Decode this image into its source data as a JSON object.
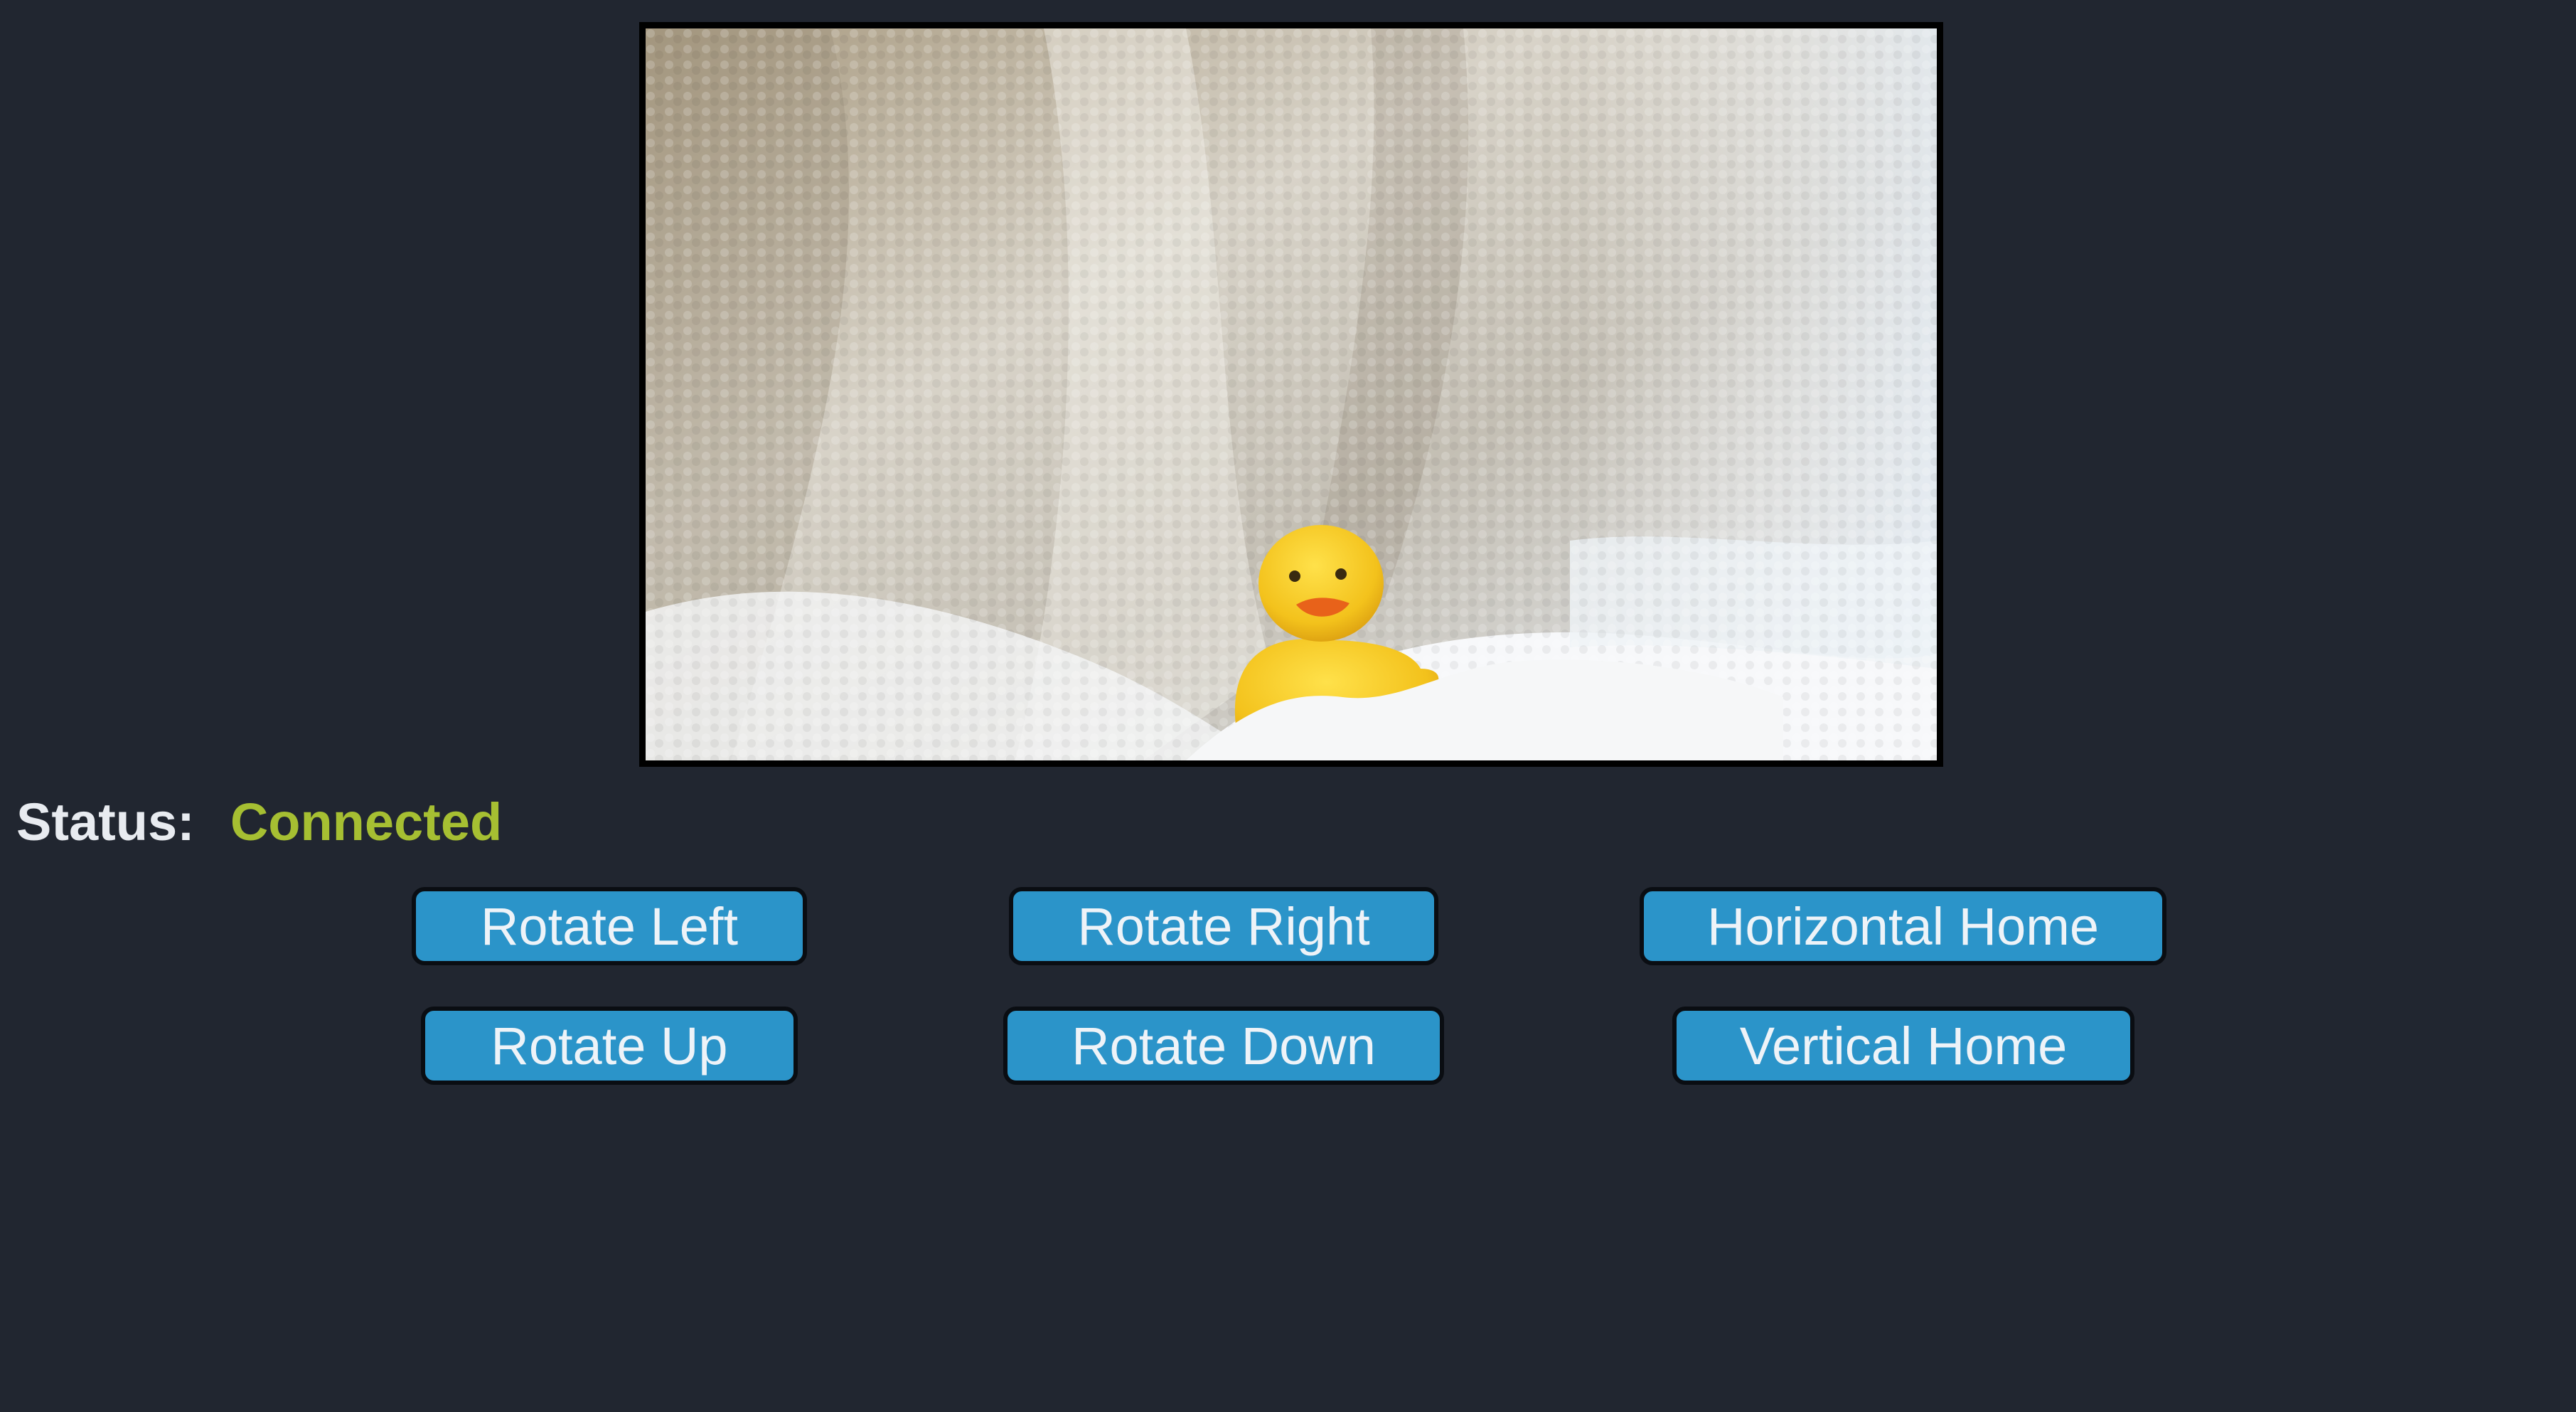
{
  "status": {
    "label": "Status:",
    "value": "Connected",
    "value_color": "#a6bf32"
  },
  "camera_feed": {
    "subject": "yellow rubber duck on white sherpa blanket"
  },
  "controls": {
    "button_color": "#2b94c9",
    "rotate_left": "Rotate Left",
    "rotate_right": "Rotate Right",
    "horizontal_home": "Horizontal Home",
    "rotate_up": "Rotate Up",
    "rotate_down": "Rotate Down",
    "vertical_home": "Vertical Home"
  }
}
